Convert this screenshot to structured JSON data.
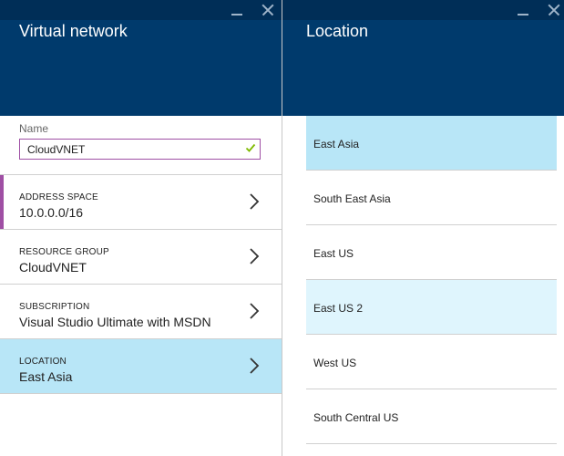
{
  "left_blade": {
    "title": "Virtual network",
    "name_field": {
      "label": "Name",
      "value": "CloudVNET"
    },
    "rows": [
      {
        "label": "ADDRESS SPACE",
        "value": "10.0.0.0/16"
      },
      {
        "label": "RESOURCE GROUP",
        "value": "CloudVNET"
      },
      {
        "label": "SUBSCRIPTION",
        "value": "Visual Studio Ultimate with MSDN"
      },
      {
        "label": "LOCATION",
        "value": "East Asia",
        "selected": true
      }
    ]
  },
  "right_blade": {
    "title": "Location",
    "locations": [
      {
        "name": "East Asia",
        "state": "selected"
      },
      {
        "name": "South East Asia",
        "state": "normal"
      },
      {
        "name": "East US",
        "state": "normal"
      },
      {
        "name": "East US 2",
        "state": "hover"
      },
      {
        "name": "West US",
        "state": "normal"
      },
      {
        "name": "South Central US",
        "state": "normal"
      }
    ]
  },
  "icons": {
    "minimize": "minimize-icon",
    "close": "close-icon",
    "chevron": "chevron-right-icon",
    "valid": "checkmark-icon"
  },
  "colors": {
    "header": "#003a6c",
    "accent": "#9f4fa4",
    "selected_row": "#b8e6f7",
    "hover_row": "#dff5fd",
    "valid_check": "#7fba00"
  }
}
